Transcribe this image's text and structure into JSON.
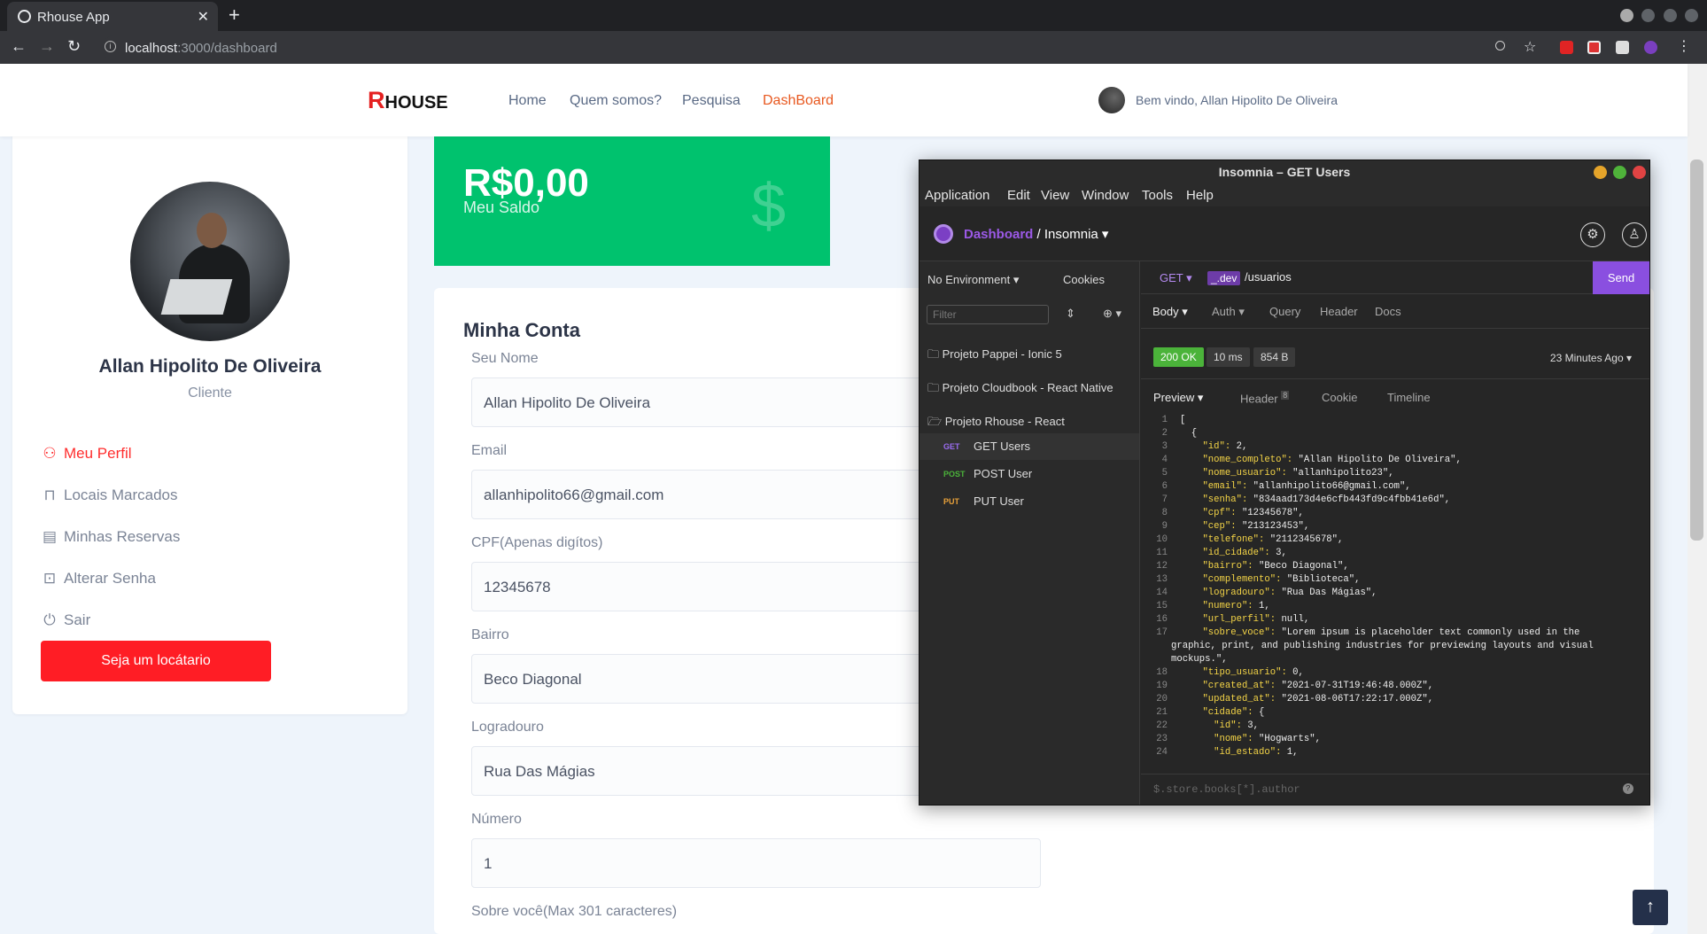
{
  "browser": {
    "tab_title": "Rhouse App",
    "url_host": "localhost",
    "url_path": ":3000/dashboard"
  },
  "site": {
    "logo_r": "R",
    "logo_rest": "HOUSE",
    "nav": [
      "Home",
      "Quem somos?",
      "Pesquisa",
      "DashBoard"
    ],
    "welcome": "Bem vindo, Allan Hipolito De Oliveira",
    "accent": "#e8581f"
  },
  "profile": {
    "name": "Allan Hipolito De Oliveira",
    "role": "Cliente",
    "menu": [
      {
        "label": "Meu Perfil",
        "icon": "user-icon"
      },
      {
        "label": "Locais Marcados",
        "icon": "bookmark-icon"
      },
      {
        "label": "Minhas Reservas",
        "icon": "book-icon"
      },
      {
        "label": "Alterar Senha",
        "icon": "lock-icon"
      },
      {
        "label": "Sair",
        "icon": "power-icon"
      }
    ],
    "cta": "Seja um locátario"
  },
  "balance": {
    "value": "R$0,00",
    "label": "Meu Saldo",
    "symbol": "$"
  },
  "account": {
    "title": "Minha Conta",
    "fields": [
      {
        "label": "Seu Nome",
        "value": "Allan Hipolito De Oliveira"
      },
      {
        "label": "Email",
        "value": "allanhipolito66@gmail.com"
      },
      {
        "label": "CPF(Apenas digítos)",
        "value": "12345678"
      },
      {
        "label": "Bairro",
        "value": "Beco Diagonal"
      },
      {
        "label": "Logradouro",
        "value": "Rua Das Mágias"
      },
      {
        "label": "Número",
        "value": "1"
      },
      {
        "label": "Sobre você(Max 301 caracteres)",
        "value": ""
      }
    ]
  },
  "insomnia": {
    "title": "Insomnia – GET Users",
    "menu": [
      "Application",
      "Edit",
      "View",
      "Window",
      "Tools",
      "Help"
    ],
    "crumb_dashboard": "Dashboard",
    "crumb_sep": "/",
    "crumb_workspace": "Insomnia",
    "environment": "No Environment",
    "cookies": "Cookies",
    "filter_placeholder": "Filter",
    "folders": [
      "Projeto Pappei - Ionic 5",
      "Projeto Cloudbook - React Native",
      "Projeto Rhouse - React"
    ],
    "requests": [
      {
        "method": "GET",
        "name": "GET Users",
        "color": "#9b6cf0"
      },
      {
        "method": "POST",
        "name": "POST User",
        "color": "#4bb33a"
      },
      {
        "method": "PUT",
        "name": "PUT User",
        "color": "#e8a13a"
      }
    ],
    "req_method": "GET",
    "req_env": "_.dev",
    "req_path": "/usuarios",
    "send": "Send",
    "req_tabs": [
      "Body",
      "Auth",
      "Query",
      "Header",
      "Docs"
    ],
    "status": "200 OK",
    "time": "10 ms",
    "size": "854 B",
    "ago": "23 Minutes Ago",
    "resp_tabs": [
      "Preview",
      "Header",
      "Cookie",
      "Timeline"
    ],
    "header_count": "8",
    "jsonpath_placeholder": "$.store.books[*].author",
    "code_lines": [
      {
        "n": "1",
        "t": "["
      },
      {
        "n": "2",
        "t": "  {"
      },
      {
        "n": "3",
        "t": "    \"id\": 2,"
      },
      {
        "n": "4",
        "t": "    \"nome_completo\": \"Allan Hipolito De Oliveira\","
      },
      {
        "n": "5",
        "t": "    \"nome_usuario\": \"allanhipolito23\","
      },
      {
        "n": "6",
        "t": "    \"email\": \"allanhipolito66@gmail.com\","
      },
      {
        "n": "7",
        "t": "    \"senha\": \"834aad173d4e6cfb443fd9c4fbb41e6d\","
      },
      {
        "n": "8",
        "t": "    \"cpf\": \"12345678\","
      },
      {
        "n": "9",
        "t": "    \"cep\": \"213123453\","
      },
      {
        "n": "10",
        "t": "    \"telefone\": \"2112345678\","
      },
      {
        "n": "11",
        "t": "    \"id_cidade\": 3,"
      },
      {
        "n": "12",
        "t": "    \"bairro\": \"Beco Diagonal\","
      },
      {
        "n": "13",
        "t": "    \"complemento\": \"Biblioteca\","
      },
      {
        "n": "14",
        "t": "    \"logradouro\": \"Rua Das Mágias\","
      },
      {
        "n": "15",
        "t": "    \"numero\": 1,"
      },
      {
        "n": "16",
        "t": "    \"url_perfil\": null,"
      },
      {
        "n": "17",
        "t": "    \"sobre_voce\": \"Lorem ipsum is placeholder text commonly used in the"
      },
      {
        "n": "",
        "t": "graphic, print, and publishing industries for previewing layouts and visual"
      },
      {
        "n": "",
        "t": "mockups.\","
      },
      {
        "n": "18",
        "t": "    \"tipo_usuario\": 0,"
      },
      {
        "n": "19",
        "t": "    \"created_at\": \"2021-07-31T19:46:48.000Z\","
      },
      {
        "n": "20",
        "t": "    \"updated_at\": \"2021-08-06T17:22:17.000Z\","
      },
      {
        "n": "21",
        "t": "    \"cidade\": {"
      },
      {
        "n": "22",
        "t": "      \"id\": 3,"
      },
      {
        "n": "23",
        "t": "      \"nome\": \"Hogwarts\","
      },
      {
        "n": "24",
        "t": "      \"id_estado\": 1,"
      }
    ]
  }
}
